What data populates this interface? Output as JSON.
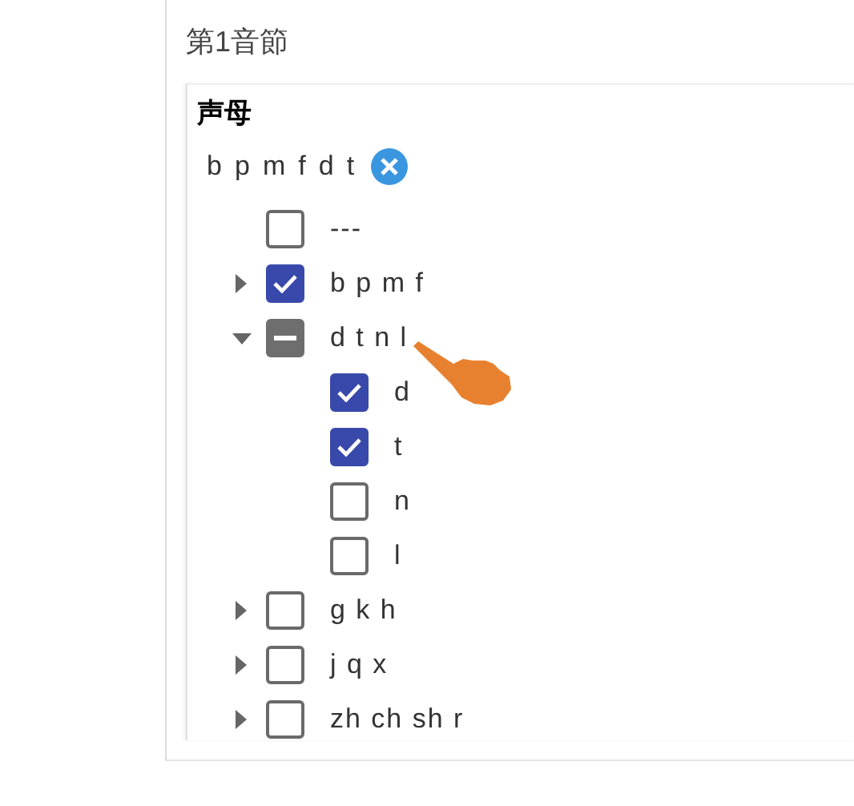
{
  "section_title": "第1音節",
  "group": {
    "title": "声母",
    "selection": [
      "b",
      "p",
      "m",
      "f",
      "d",
      "t"
    ],
    "items": [
      {
        "label": "---",
        "checked": false,
        "indeterminate": false
      },
      {
        "label": "b p m f",
        "checked": true,
        "indeterminate": false,
        "expanded": false
      },
      {
        "label": "d t n l",
        "checked": false,
        "indeterminate": true,
        "expanded": true,
        "children": [
          {
            "label": "d",
            "checked": true
          },
          {
            "label": "t",
            "checked": true
          },
          {
            "label": "n",
            "checked": false
          },
          {
            "label": "l",
            "checked": false
          }
        ]
      },
      {
        "label": "g k h",
        "checked": false,
        "indeterminate": false,
        "expanded": false
      },
      {
        "label": "j q x",
        "checked": false,
        "indeterminate": false,
        "expanded": false
      },
      {
        "label": "zh ch sh r",
        "checked": false,
        "indeterminate": false,
        "expanded": false
      }
    ]
  }
}
